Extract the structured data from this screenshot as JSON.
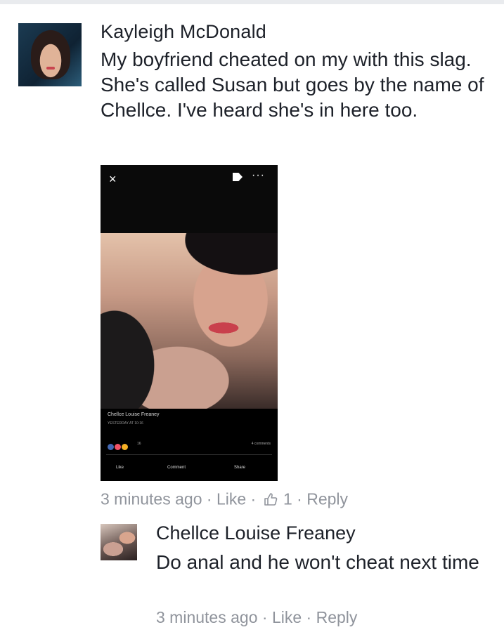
{
  "comment": {
    "author": "Kayleigh McDonald",
    "text": "My boyfriend cheated on my with this slag. She's called Susan but goes by the name of Chellce. I've heard she's in here too.",
    "meta": {
      "time": "3 minutes ago",
      "sep": "·",
      "like": "Like",
      "like_count": "1",
      "reply": "Reply"
    },
    "attachment": {
      "close": "×",
      "more": "···",
      "poster_name": "Chellce Louise Freaney",
      "poster_date": "YESTERDAY AT 10:16",
      "reaction_count": "16",
      "comments_count": "4 comments",
      "like": "Like",
      "comment": "Comment",
      "share": "Share"
    }
  },
  "reply": {
    "author": "Chellce Louise Freaney",
    "text": "Do anal and he won't cheat next time",
    "meta": {
      "time": "3 minutes ago",
      "sep": "·",
      "like": "Like",
      "reply": "Reply"
    }
  },
  "colors": {
    "text": "#1d2129",
    "meta": "#90949c",
    "screenshot_bg": "#000000"
  },
  "icons": [
    "thumbs-up-icon",
    "close-icon",
    "tag-icon",
    "more-icon"
  ]
}
